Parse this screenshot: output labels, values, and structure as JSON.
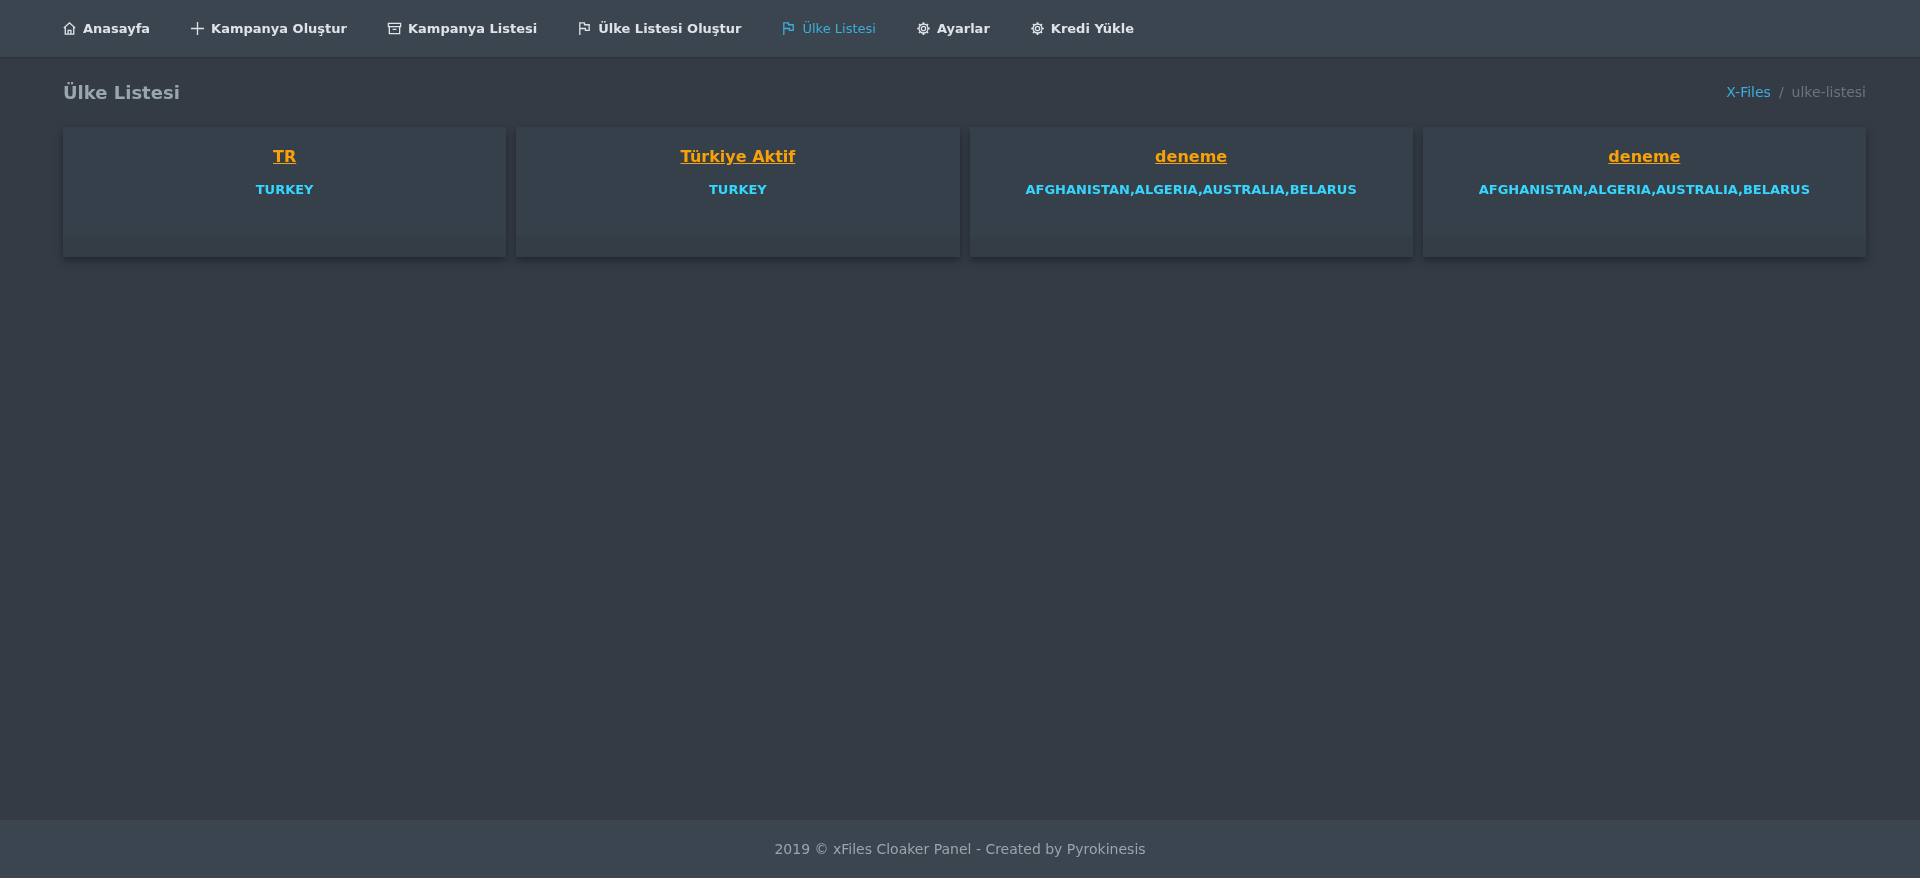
{
  "nav": {
    "items": [
      {
        "label": "Anasayfa",
        "selected": false
      },
      {
        "label": "Kampanya Oluştur",
        "selected": false
      },
      {
        "label": "Kampanya Listesi",
        "selected": false
      },
      {
        "label": "Ülke Listesi Oluştur",
        "selected": false
      },
      {
        "label": "Ülke Listesi",
        "selected": true
      },
      {
        "label": "Ayarlar",
        "selected": false
      },
      {
        "label": "Kredi Yükle",
        "selected": false
      }
    ]
  },
  "page": {
    "title": "Ülke Listesi",
    "breadcrumb_separator": "/",
    "breadcrumb": [
      {
        "label": "X-Files",
        "kind": "link"
      },
      {
        "label": "ulke-listesi",
        "kind": "current"
      }
    ]
  },
  "cards": [
    {
      "title": "TR",
      "countries": "TURKEY"
    },
    {
      "title": "Türkiye Aktif",
      "countries": "TURKEY"
    },
    {
      "title": "deneme",
      "countries": "AFGHANISTAN,ALGERIA,AUSTRALIA,BELARUS"
    },
    {
      "title": "deneme",
      "countries": "AFGHANISTAN,ALGERIA,AUSTRALIA,BELARUS"
    }
  ],
  "footer": {
    "text": "2019 © xFiles Cloaker Panel - Created by Pyrokinesis"
  }
}
